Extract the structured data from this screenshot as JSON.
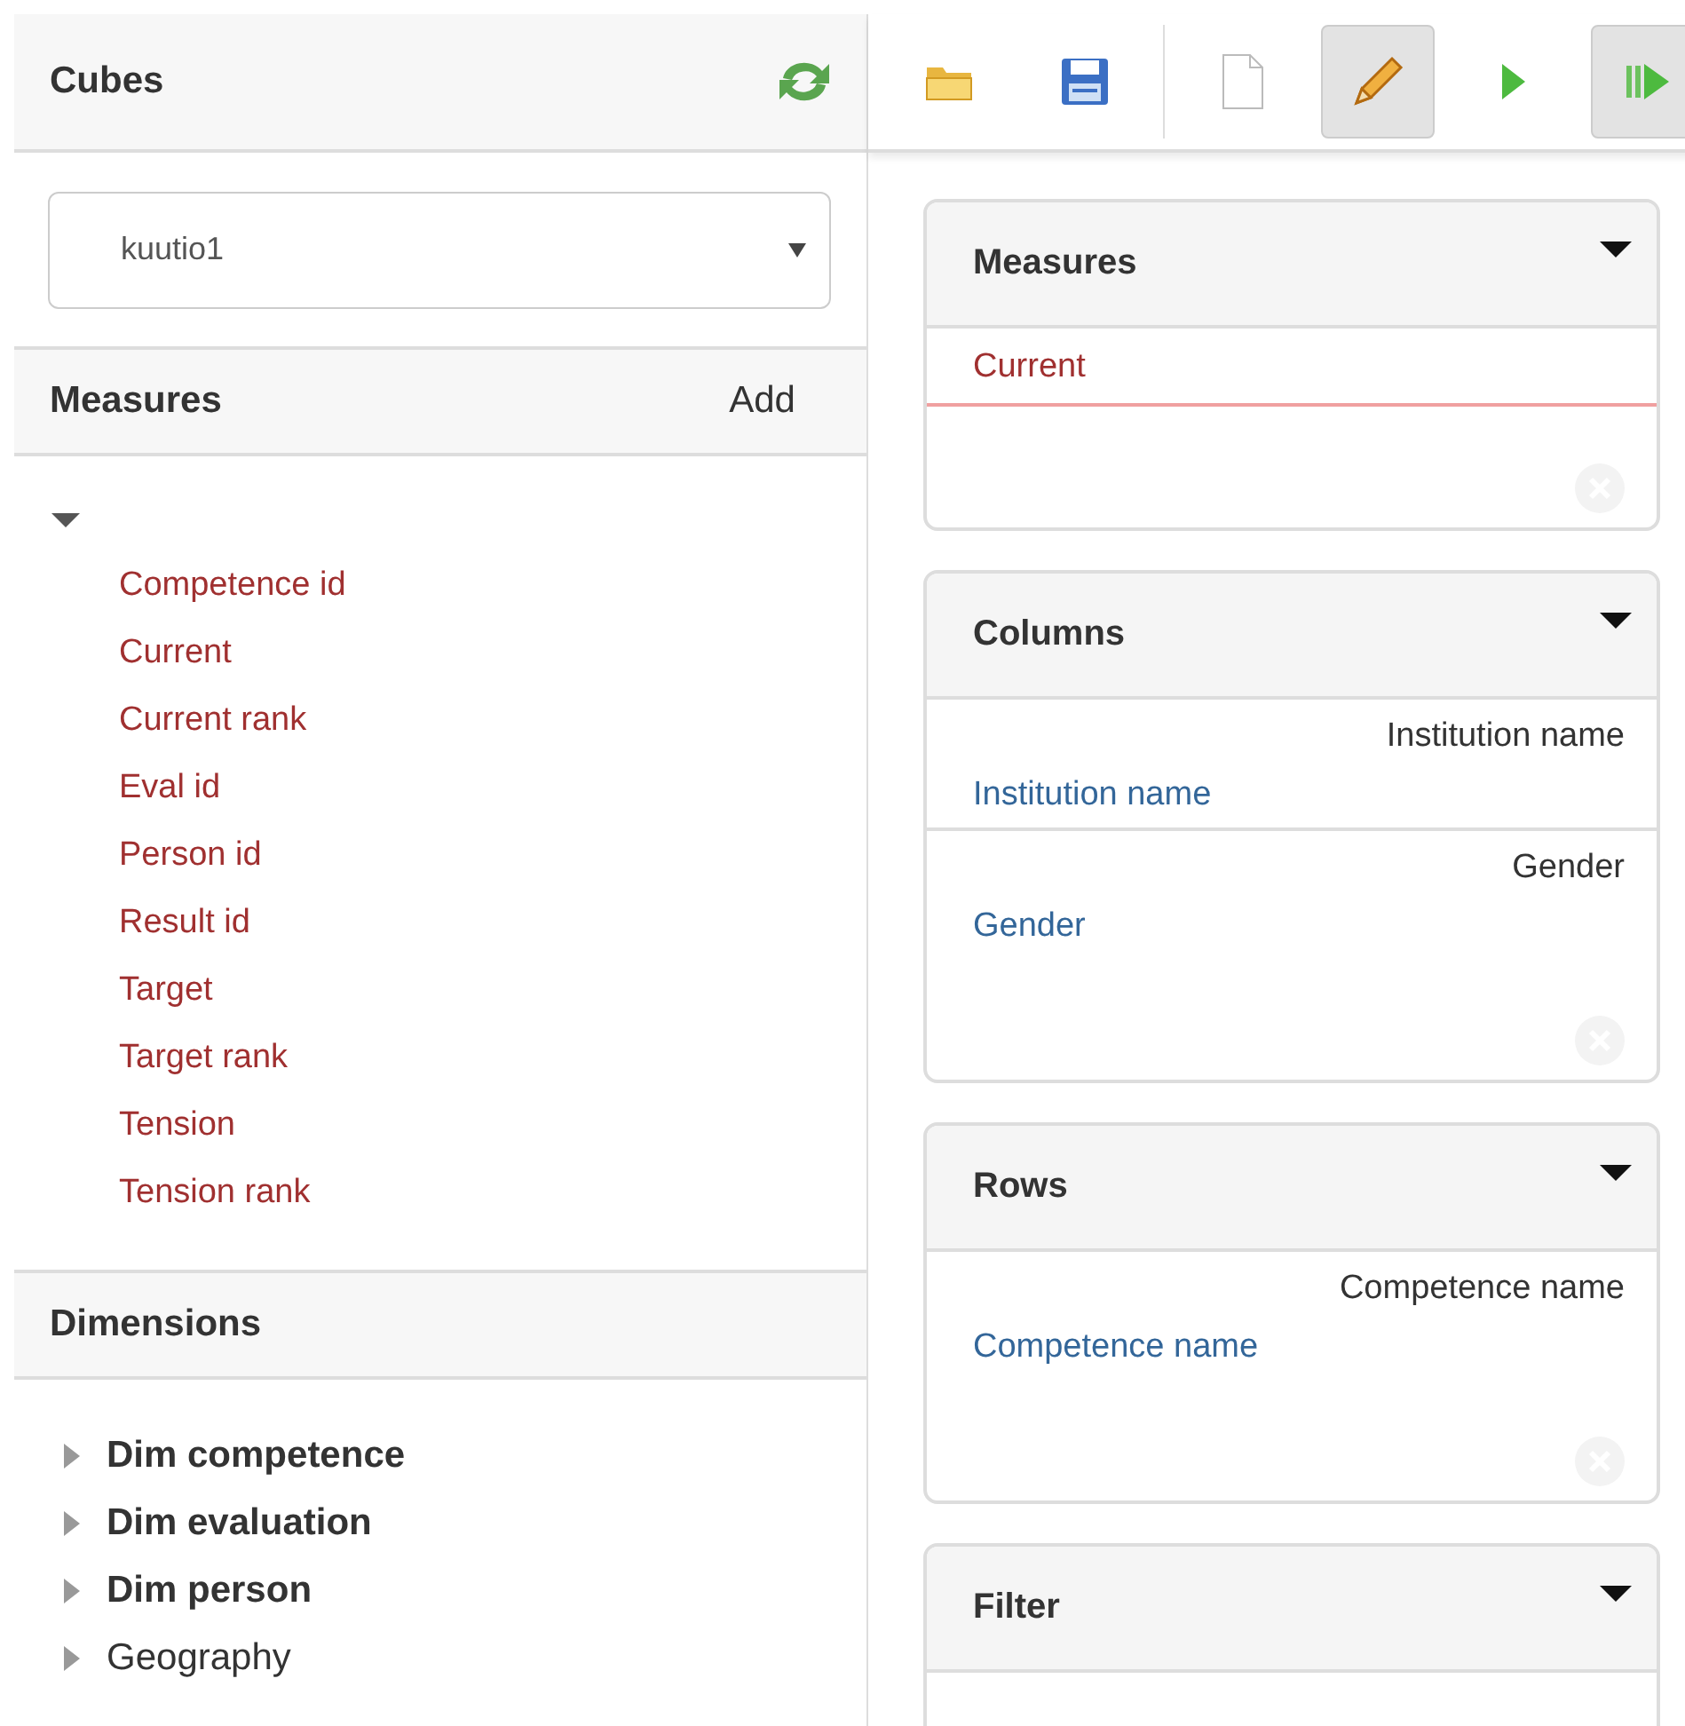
{
  "cubes": {
    "title": "Cubes",
    "selected_cube": "kuutio1"
  },
  "toolbar": [
    {
      "kind": "open",
      "pressed": false
    },
    {
      "kind": "save",
      "pressed": false
    },
    {
      "kind": "new",
      "pressed": false
    },
    {
      "kind": "edit",
      "pressed": true
    },
    {
      "kind": "run",
      "pressed": false
    },
    {
      "kind": "run-all",
      "pressed": true
    }
  ],
  "measures": {
    "title": "Measures",
    "action": "Add",
    "expanded": true,
    "items": [
      "Competence id",
      "Current",
      "Current rank",
      "Eval id",
      "Person id",
      "Result id",
      "Target",
      "Target rank",
      "Tension",
      "Tension rank"
    ]
  },
  "dimensions": {
    "title": "Dimensions",
    "items": [
      {
        "label": "Dim competence",
        "kind": "dimension",
        "expanded": false
      },
      {
        "label": "Dim evaluation",
        "kind": "dimension",
        "expanded": false
      },
      {
        "label": "Dim person",
        "kind": "dimension",
        "expanded": false
      },
      {
        "label": "Geography",
        "kind": "hierarchy",
        "expanded": false
      }
    ]
  },
  "query": [
    {
      "title": "Measures",
      "groups": [
        {
          "items": [
            {
              "kind": "measure",
              "label": "Current"
            }
          ]
        }
      ]
    },
    {
      "title": "Columns",
      "groups": [
        {
          "header": "Institution name",
          "items": [
            {
              "kind": "level",
              "label": "Institution name"
            }
          ]
        },
        {
          "header": "Gender",
          "items": [
            {
              "kind": "level",
              "label": "Gender"
            }
          ]
        }
      ]
    },
    {
      "title": "Rows",
      "groups": [
        {
          "header": "Competence name",
          "items": [
            {
              "kind": "level",
              "label": "Competence name"
            }
          ]
        }
      ]
    },
    {
      "title": "Filter"
    }
  ]
}
